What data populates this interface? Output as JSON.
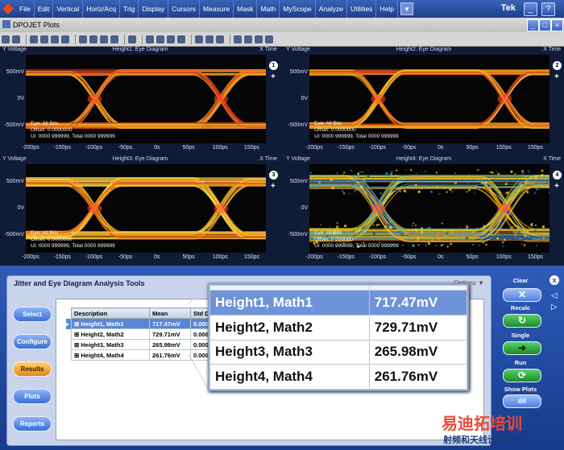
{
  "menubar": {
    "items": [
      "File",
      "Edit",
      "Vertical",
      "Horiz/Acq",
      "Trig",
      "Display",
      "Cursors",
      "Measure",
      "Mask",
      "Math",
      "MyScope",
      "Analyze",
      "Utilities",
      "Help"
    ],
    "brand": "Tek",
    "dropdown_glyph": "▼"
  },
  "window": {
    "title": "DPOJET Plots"
  },
  "plots": [
    {
      "title": "Height1: Eye Diagram",
      "vlabel": "Y Voltage",
      "tlabel": "X Time",
      "num": "1",
      "plus": "+",
      "info": [
        "Eye: All Bits",
        "Offset: 0.0000000",
        "Ui: 0000 999999, Total 0000 999999"
      ],
      "yticks": [
        "500mV",
        "0V",
        "-500mV"
      ],
      "xticks": [
        "-200ps",
        "-150ps",
        "-100ps",
        "-50ps",
        "0s",
        "50ps",
        "100ps",
        "150ps"
      ],
      "style": "clean"
    },
    {
      "title": "Height2: Eye Diagram",
      "vlabel": "Y Voltage",
      "tlabel": "X Time",
      "num": "2",
      "plus": "+",
      "info": [
        "Eye: All Bits",
        "Offset: 0.0000000",
        "Ui: 0000 999999, Total 0000 999999"
      ],
      "yticks": [
        "500mV",
        "0V",
        "-500mV"
      ],
      "xticks": [
        "-200ps",
        "-150ps",
        "-100ps",
        "-50ps",
        "0s",
        "50ps",
        "100ps",
        "150ps"
      ],
      "style": "clean"
    },
    {
      "title": "Height3: Eye Diagram",
      "vlabel": "Y Voltage",
      "tlabel": "X Time",
      "num": "3",
      "plus": "+",
      "info": [
        "Eye: All Bits",
        "Offset: 0.0000000",
        "Ui: 0000 999999, Total 0000 999999"
      ],
      "yticks": [
        "500mV",
        "0V",
        "-500mV"
      ],
      "xticks": [
        "-200ps",
        "-150ps",
        "-100ps",
        "-50ps",
        "0s",
        "50ps",
        "100ps",
        "150ps"
      ],
      "style": "medium"
    },
    {
      "title": "Height4: Eye Diagram",
      "vlabel": "Y Voltage",
      "tlabel": "X Time",
      "num": "4",
      "plus": "+",
      "info": [
        "Eye: All Bits",
        "Offset: 0.000000",
        "Ui: 0000 999999, Total 0000 999999"
      ],
      "yticks": [
        "500mV",
        "0V",
        "-500mV"
      ],
      "xticks": [
        "-200ps",
        "-150ps",
        "-100ps",
        "-50ps",
        "0s",
        "50ps",
        "100ps",
        "150ps"
      ],
      "style": "noisy"
    }
  ],
  "panel": {
    "title": "Jitter and Eye Diagram Analysis Tools",
    "options": "Options ▼",
    "side_buttons": [
      "Select",
      "Configure",
      "Results",
      "Plots",
      "Reports"
    ],
    "active_button": "Results",
    "columns": [
      "Description",
      "Mean",
      "Std De"
    ],
    "rows": [
      {
        "desc": "Height1, Math1",
        "mean": "717.47mV",
        "std": "0.0000"
      },
      {
        "desc": "Height2, Math2",
        "mean": "729.71mV",
        "std": "0.0000"
      },
      {
        "desc": "Height3, Math3",
        "mean": "265.98mV",
        "std": "0.0000"
      },
      {
        "desc": "Height4, Math4",
        "mean": "261.76mV",
        "std": "0.0000"
      }
    ],
    "row_expander": "⊞",
    "selected_marker": "▸"
  },
  "zoom": {
    "rows": [
      {
        "desc": "Height1, Math1",
        "mean": "717.47mV"
      },
      {
        "desc": "Height2, Math2",
        "mean": "729.71mV"
      },
      {
        "desc": "Height3, Math3",
        "mean": "265.98mV"
      },
      {
        "desc": "Height4, Math4",
        "mean": "261.76mV"
      }
    ]
  },
  "controls": {
    "clear": "Clear",
    "recalc": "Recalc",
    "single": "Single",
    "run": "Run",
    "show_plots": "Show Plots",
    "close_glyph": "x"
  },
  "watermark": {
    "line1": "易迪拓培训",
    "line2": "射频和天线设计专家"
  },
  "colors": {
    "accent": "#2f5bb8",
    "selected": "#5b86d6",
    "active_button": "#e48a12"
  }
}
